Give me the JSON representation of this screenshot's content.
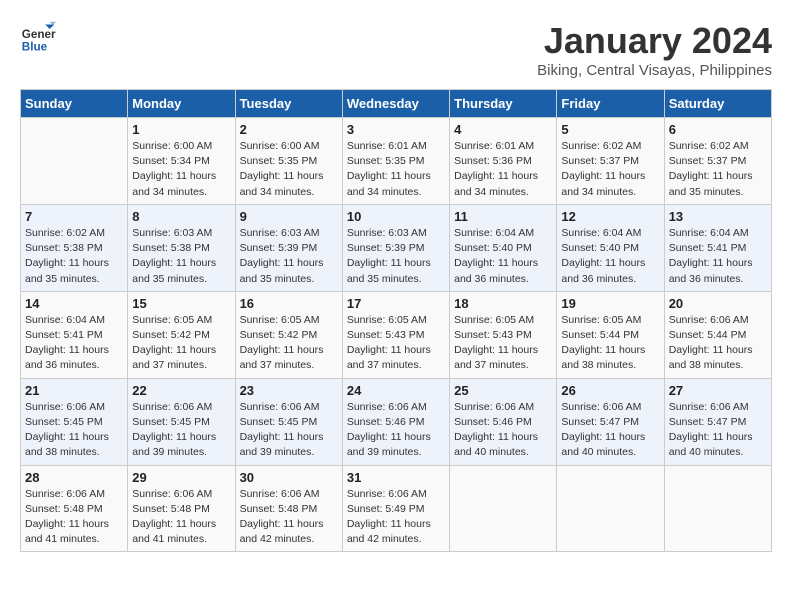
{
  "header": {
    "logo_text_general": "General",
    "logo_text_blue": "Blue",
    "title": "January 2024",
    "subtitle": "Biking, Central Visayas, Philippines"
  },
  "columns": [
    "Sunday",
    "Monday",
    "Tuesday",
    "Wednesday",
    "Thursday",
    "Friday",
    "Saturday"
  ],
  "weeks": [
    [
      {
        "day": "",
        "detail": ""
      },
      {
        "day": "1",
        "detail": "Sunrise: 6:00 AM\nSunset: 5:34 PM\nDaylight: 11 hours\nand 34 minutes."
      },
      {
        "day": "2",
        "detail": "Sunrise: 6:00 AM\nSunset: 5:35 PM\nDaylight: 11 hours\nand 34 minutes."
      },
      {
        "day": "3",
        "detail": "Sunrise: 6:01 AM\nSunset: 5:35 PM\nDaylight: 11 hours\nand 34 minutes."
      },
      {
        "day": "4",
        "detail": "Sunrise: 6:01 AM\nSunset: 5:36 PM\nDaylight: 11 hours\nand 34 minutes."
      },
      {
        "day": "5",
        "detail": "Sunrise: 6:02 AM\nSunset: 5:37 PM\nDaylight: 11 hours\nand 34 minutes."
      },
      {
        "day": "6",
        "detail": "Sunrise: 6:02 AM\nSunset: 5:37 PM\nDaylight: 11 hours\nand 35 minutes."
      }
    ],
    [
      {
        "day": "7",
        "detail": "Sunrise: 6:02 AM\nSunset: 5:38 PM\nDaylight: 11 hours\nand 35 minutes."
      },
      {
        "day": "8",
        "detail": "Sunrise: 6:03 AM\nSunset: 5:38 PM\nDaylight: 11 hours\nand 35 minutes."
      },
      {
        "day": "9",
        "detail": "Sunrise: 6:03 AM\nSunset: 5:39 PM\nDaylight: 11 hours\nand 35 minutes."
      },
      {
        "day": "10",
        "detail": "Sunrise: 6:03 AM\nSunset: 5:39 PM\nDaylight: 11 hours\nand 35 minutes."
      },
      {
        "day": "11",
        "detail": "Sunrise: 6:04 AM\nSunset: 5:40 PM\nDaylight: 11 hours\nand 36 minutes."
      },
      {
        "day": "12",
        "detail": "Sunrise: 6:04 AM\nSunset: 5:40 PM\nDaylight: 11 hours\nand 36 minutes."
      },
      {
        "day": "13",
        "detail": "Sunrise: 6:04 AM\nSunset: 5:41 PM\nDaylight: 11 hours\nand 36 minutes."
      }
    ],
    [
      {
        "day": "14",
        "detail": "Sunrise: 6:04 AM\nSunset: 5:41 PM\nDaylight: 11 hours\nand 36 minutes."
      },
      {
        "day": "15",
        "detail": "Sunrise: 6:05 AM\nSunset: 5:42 PM\nDaylight: 11 hours\nand 37 minutes."
      },
      {
        "day": "16",
        "detail": "Sunrise: 6:05 AM\nSunset: 5:42 PM\nDaylight: 11 hours\nand 37 minutes."
      },
      {
        "day": "17",
        "detail": "Sunrise: 6:05 AM\nSunset: 5:43 PM\nDaylight: 11 hours\nand 37 minutes."
      },
      {
        "day": "18",
        "detail": "Sunrise: 6:05 AM\nSunset: 5:43 PM\nDaylight: 11 hours\nand 37 minutes."
      },
      {
        "day": "19",
        "detail": "Sunrise: 6:05 AM\nSunset: 5:44 PM\nDaylight: 11 hours\nand 38 minutes."
      },
      {
        "day": "20",
        "detail": "Sunrise: 6:06 AM\nSunset: 5:44 PM\nDaylight: 11 hours\nand 38 minutes."
      }
    ],
    [
      {
        "day": "21",
        "detail": "Sunrise: 6:06 AM\nSunset: 5:45 PM\nDaylight: 11 hours\nand 38 minutes."
      },
      {
        "day": "22",
        "detail": "Sunrise: 6:06 AM\nSunset: 5:45 PM\nDaylight: 11 hours\nand 39 minutes."
      },
      {
        "day": "23",
        "detail": "Sunrise: 6:06 AM\nSunset: 5:45 PM\nDaylight: 11 hours\nand 39 minutes."
      },
      {
        "day": "24",
        "detail": "Sunrise: 6:06 AM\nSunset: 5:46 PM\nDaylight: 11 hours\nand 39 minutes."
      },
      {
        "day": "25",
        "detail": "Sunrise: 6:06 AM\nSunset: 5:46 PM\nDaylight: 11 hours\nand 40 minutes."
      },
      {
        "day": "26",
        "detail": "Sunrise: 6:06 AM\nSunset: 5:47 PM\nDaylight: 11 hours\nand 40 minutes."
      },
      {
        "day": "27",
        "detail": "Sunrise: 6:06 AM\nSunset: 5:47 PM\nDaylight: 11 hours\nand 40 minutes."
      }
    ],
    [
      {
        "day": "28",
        "detail": "Sunrise: 6:06 AM\nSunset: 5:48 PM\nDaylight: 11 hours\nand 41 minutes."
      },
      {
        "day": "29",
        "detail": "Sunrise: 6:06 AM\nSunset: 5:48 PM\nDaylight: 11 hours\nand 41 minutes."
      },
      {
        "day": "30",
        "detail": "Sunrise: 6:06 AM\nSunset: 5:48 PM\nDaylight: 11 hours\nand 42 minutes."
      },
      {
        "day": "31",
        "detail": "Sunrise: 6:06 AM\nSunset: 5:49 PM\nDaylight: 11 hours\nand 42 minutes."
      },
      {
        "day": "",
        "detail": ""
      },
      {
        "day": "",
        "detail": ""
      },
      {
        "day": "",
        "detail": ""
      }
    ]
  ]
}
